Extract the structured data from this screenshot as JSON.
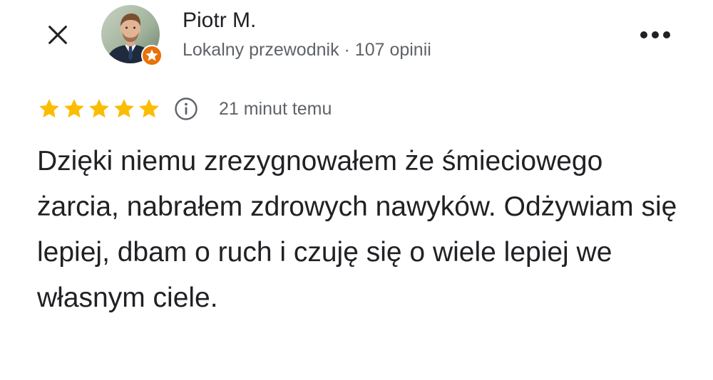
{
  "reviewer": {
    "name": "Piotr M.",
    "meta": "Lokalny przewodnik · 107 opinii",
    "avatar_icon": "person-photo",
    "badge_icon": "local-guide-star-badge",
    "badge_color": "#e8710a"
  },
  "actions": {
    "close_icon": "close-icon",
    "more_icon": "more-horizontal-icon"
  },
  "review": {
    "rating": 5,
    "rating_max": 5,
    "star_color": "#fbbc04",
    "info_icon": "info-icon",
    "time": "21 minut temu",
    "text": "Dzięki niemu zrezygnowałem że śmieciowego żarcia, nabrałem zdrowych nawyków. Odżywiam się lepiej, dbam o ruch i czuję się o wiele lepiej we własnym ciele."
  }
}
